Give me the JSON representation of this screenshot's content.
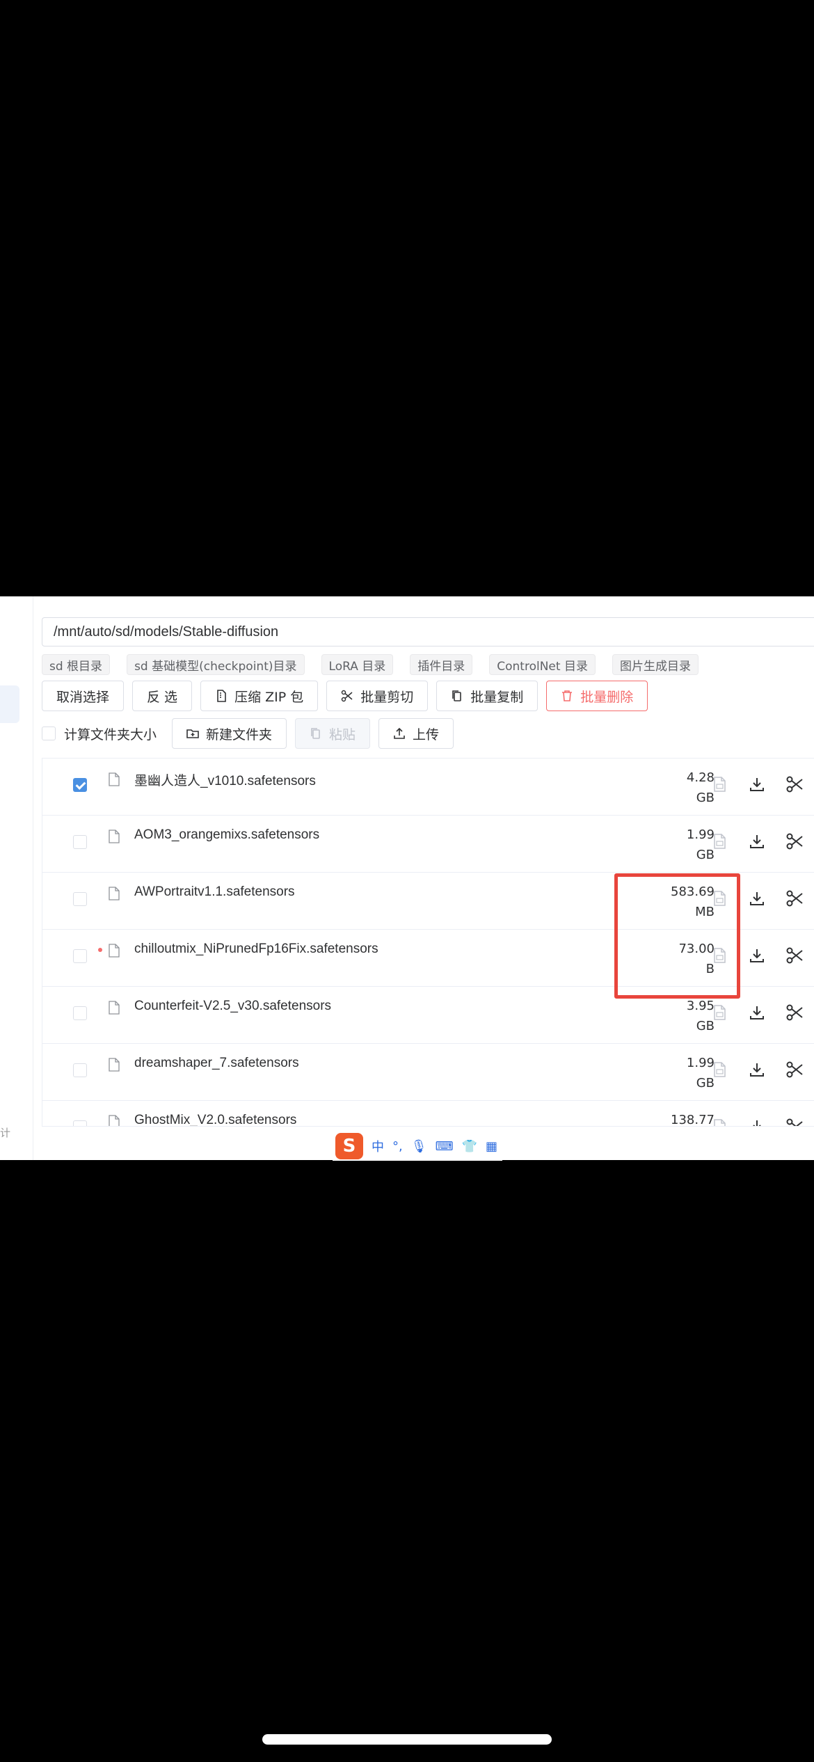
{
  "path": "/mnt/auto/sd/models/Stable-diffusion",
  "left_edge_text": "计",
  "shortcuts": [
    {
      "label": "sd 根目录"
    },
    {
      "label": "sd 基础模型(checkpoint)目录"
    },
    {
      "label": "LoRA 目录"
    },
    {
      "label": "插件目录"
    },
    {
      "label": "ControlNet 目录"
    },
    {
      "label": "图片生成目录"
    }
  ],
  "toolbar": {
    "cancel_select": "取消选择",
    "invert_select": "反 选",
    "zip": "压缩 ZIP 包",
    "batch_cut": "批量剪切",
    "batch_copy": "批量复制",
    "batch_delete": "批量删除",
    "calc_size": "计算文件夹大小",
    "new_folder": "新建文件夹",
    "paste": "粘贴",
    "upload": "上传"
  },
  "files": [
    {
      "name": "墨幽人造人_v1010.safetensors",
      "size": "4.28\nGB",
      "checked": true,
      "modified": false
    },
    {
      "name": "AOM3_orangemixs.safetensors",
      "size": "1.99\nGB",
      "checked": false,
      "modified": false
    },
    {
      "name": "AWPortraitv1.1.safetensors",
      "size": "583.69\nMB",
      "checked": false,
      "modified": false
    },
    {
      "name": "chilloutmix_NiPrunedFp16Fix.safetensors",
      "size": "73.00\nB",
      "checked": false,
      "modified": true
    },
    {
      "name": "Counterfeit-V2.5_v30.safetensors",
      "size": "3.95\nGB",
      "checked": false,
      "modified": false
    },
    {
      "name": "dreamshaper_7.safetensors",
      "size": "1.99\nGB",
      "checked": false,
      "modified": false
    },
    {
      "name": "GhostMix_V2.0.safetensors",
      "size": "138.77",
      "checked": false,
      "modified": false
    }
  ],
  "ime": {
    "logo": "S",
    "lang": "中",
    "punct": "°,",
    "mic": "🎙",
    "keyboard": "⌨",
    "skin": "👕",
    "apps": "▦"
  },
  "colors": {
    "primary": "#4a90e2",
    "danger": "#f56c6c",
    "highlight": "#e8453c"
  }
}
